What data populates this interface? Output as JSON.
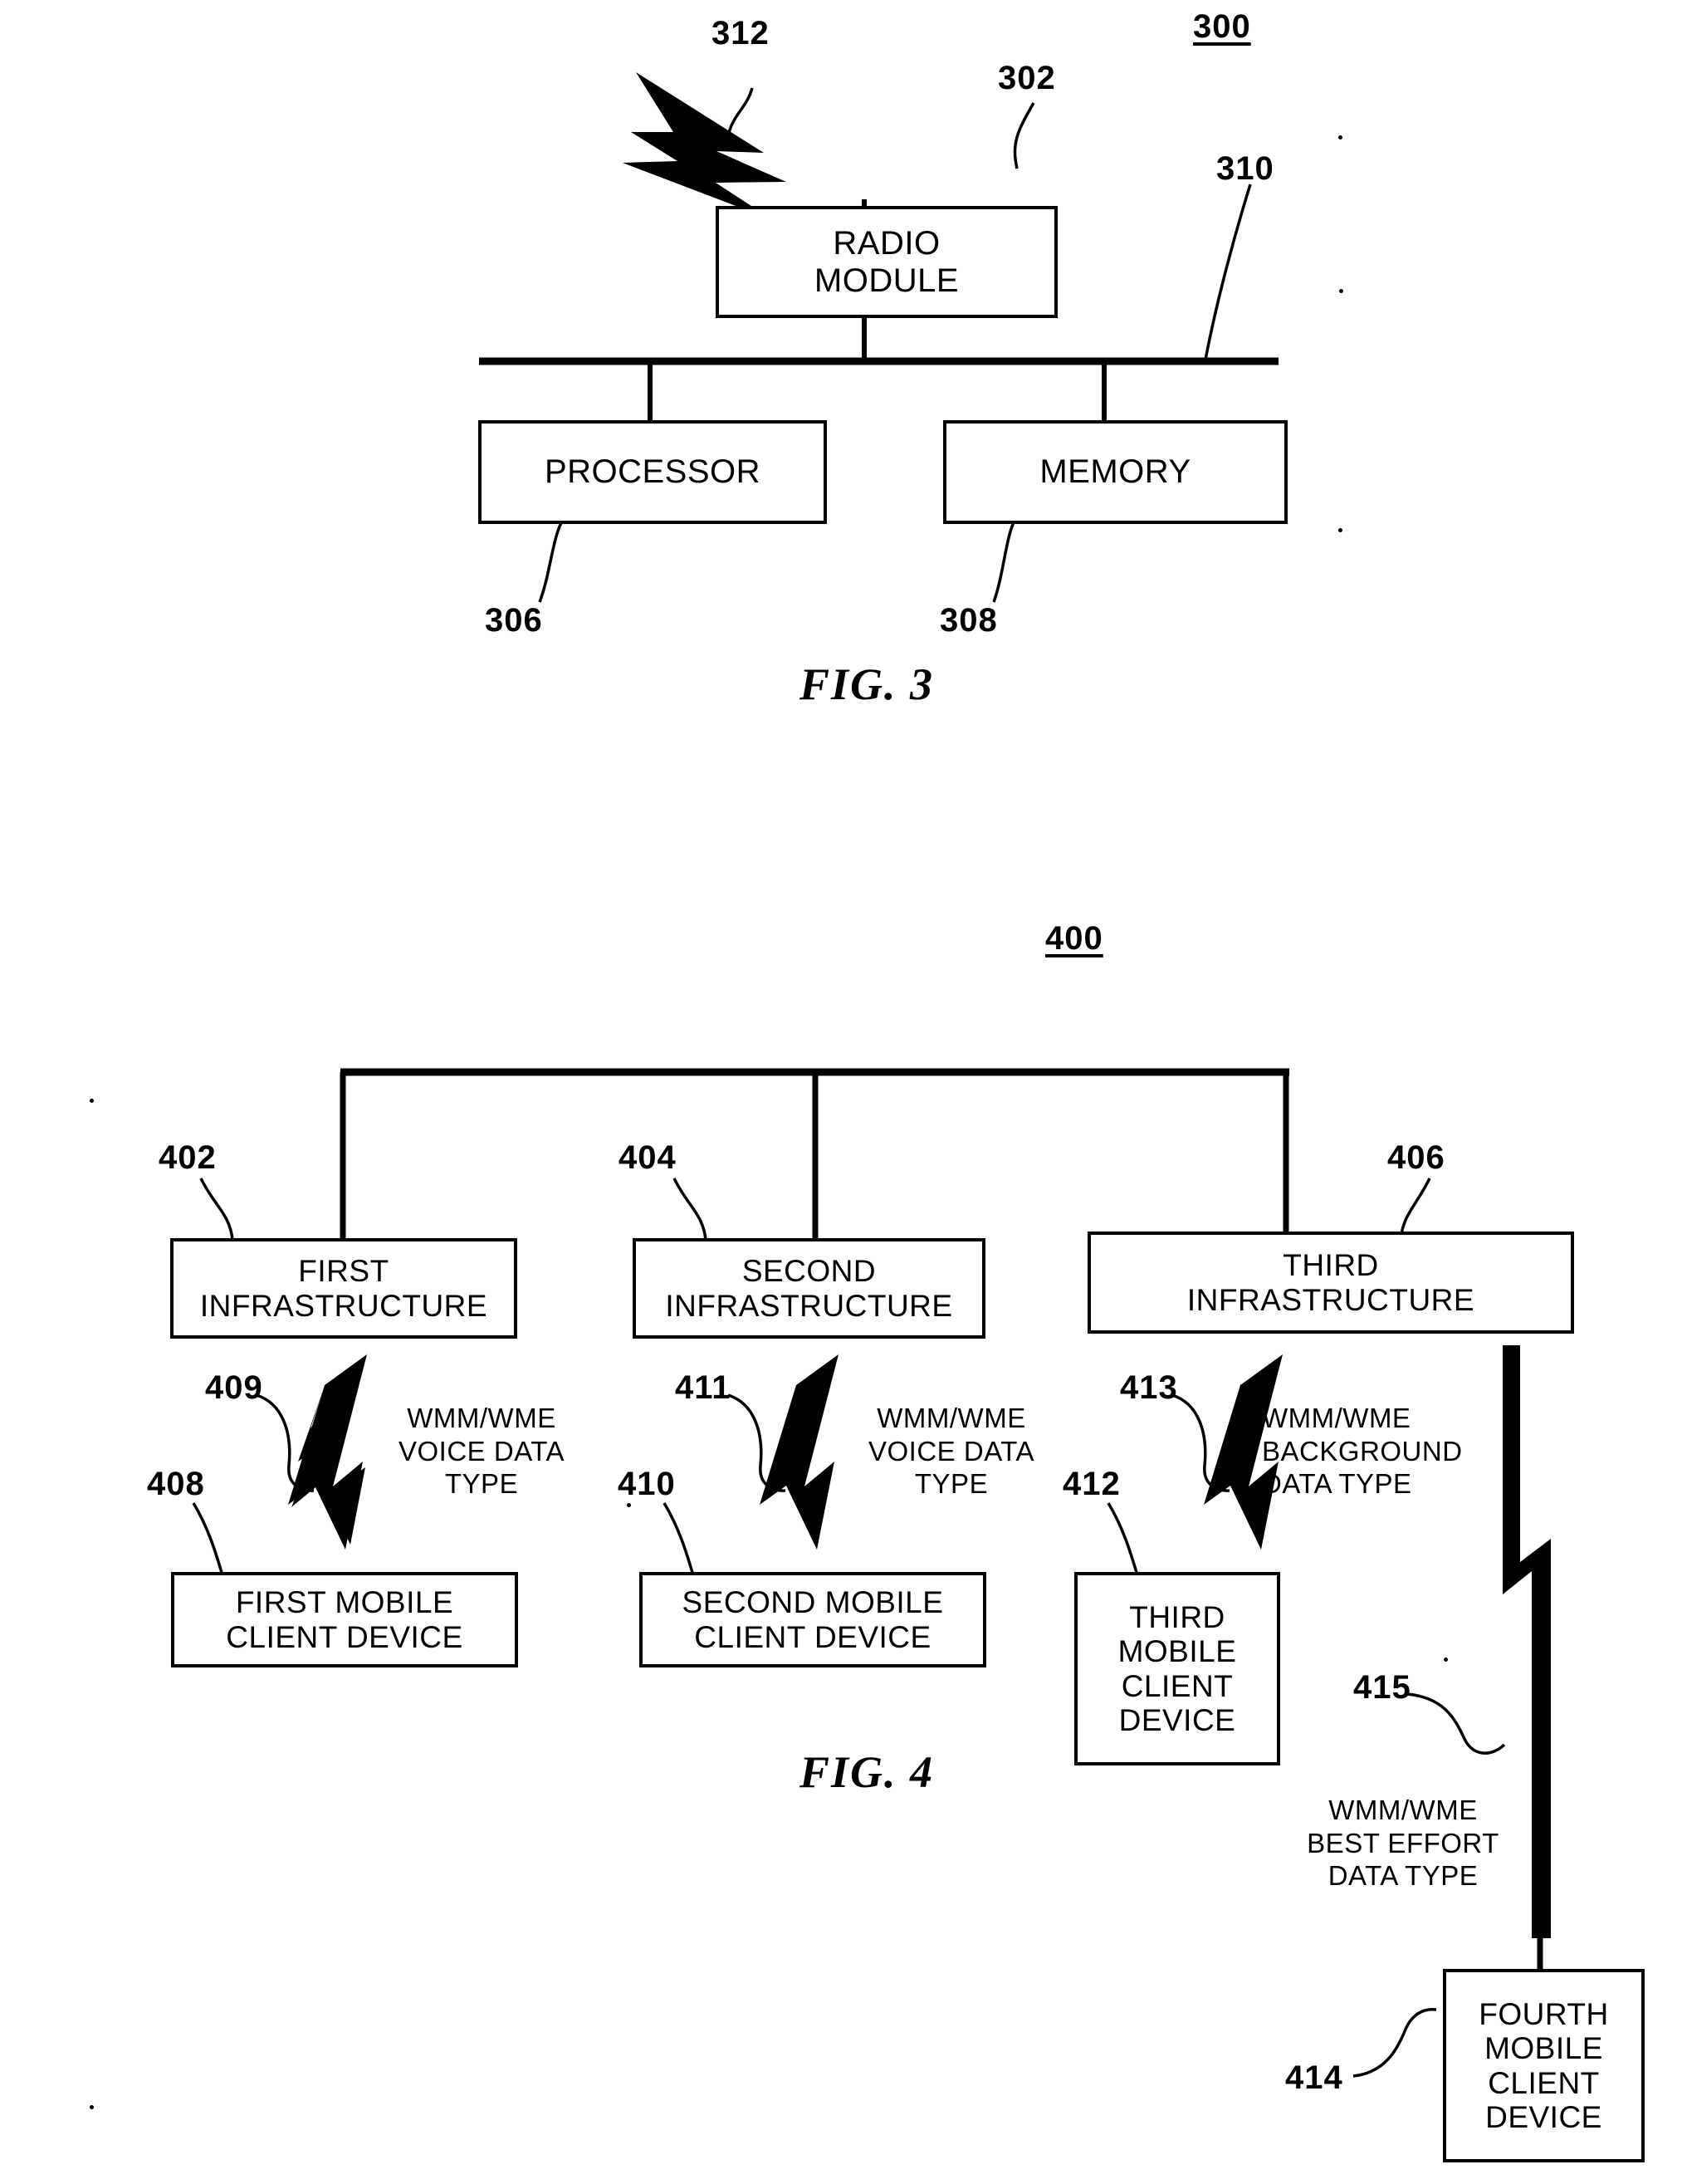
{
  "document": {
    "type": "patent-drawing-sheet",
    "figures": [
      "FIG. 3",
      "FIG. 4"
    ]
  },
  "fig3": {
    "caption": "FIG. 3",
    "system_ref": "300",
    "blocks": [
      {
        "id": "radio-module",
        "label": "RADIO\nMODULE",
        "ref": "302"
      },
      {
        "id": "processor",
        "label": "PROCESSOR",
        "ref": "306"
      },
      {
        "id": "memory",
        "label": "MEMORY",
        "ref": "308"
      }
    ],
    "bus_ref": "310",
    "antenna_ref": "312"
  },
  "fig4": {
    "caption": "FIG. 4",
    "system_ref": "400",
    "infrastructures": [
      {
        "id": "first-infrastructure",
        "label": "FIRST\nINFRASTRUCTURE",
        "ref": "402"
      },
      {
        "id": "second-infrastructure",
        "label": "SECOND\nINFRASTRUCTURE",
        "ref": "404"
      },
      {
        "id": "third-infrastructure",
        "label": "THIRD\nINFRASTRUCTURE",
        "ref": "406"
      }
    ],
    "clients": [
      {
        "id": "first-mobile-client-device",
        "label": "FIRST MOBILE\nCLIENT DEVICE",
        "ref": "408"
      },
      {
        "id": "second-mobile-client-device",
        "label": "SECOND MOBILE\nCLIENT DEVICE",
        "ref": "410"
      },
      {
        "id": "third-mobile-client-device",
        "label": "THIRD\nMOBILE\nCLIENT\nDEVICE",
        "ref": "412"
      },
      {
        "id": "fourth-mobile-client-device",
        "label": "FOURTH\nMOBILE\nCLIENT\nDEVICE",
        "ref": "414"
      }
    ],
    "links": [
      {
        "id": "link-409",
        "ref": "409",
        "label": "WMM/WME\nVOICE DATA\nTYPE"
      },
      {
        "id": "link-411",
        "ref": "411",
        "label": "WMM/WME\nVOICE DATA\nTYPE"
      },
      {
        "id": "link-413",
        "ref": "413",
        "label": "WMM/WME\nBACKGROUND\nDATA TYPE"
      },
      {
        "id": "link-415",
        "ref": "415",
        "label": "WMM/WME\nBEST EFFORT\nDATA TYPE"
      }
    ]
  },
  "colors": {
    "ink": "#000000",
    "paper": "#ffffff"
  }
}
